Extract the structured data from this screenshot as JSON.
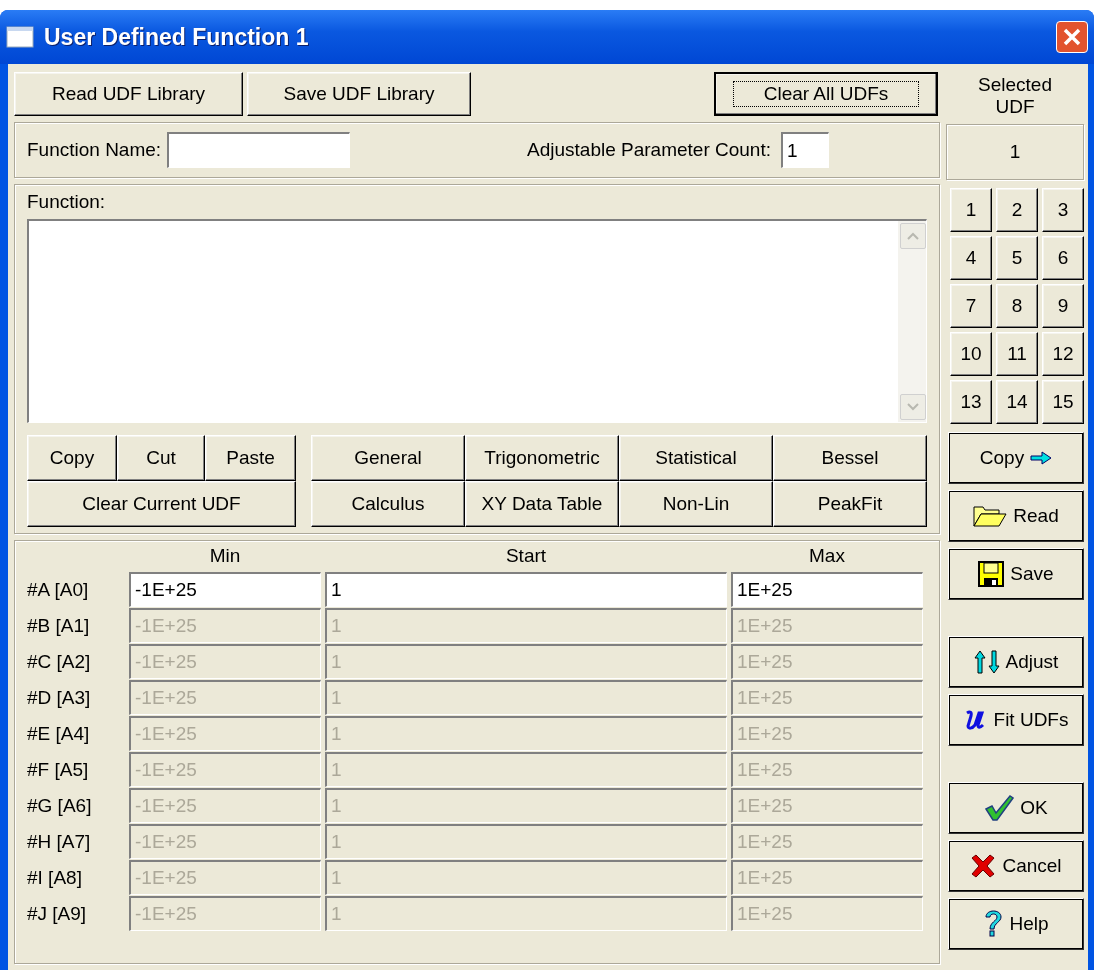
{
  "window": {
    "title": "User Defined Function 1"
  },
  "library_buttons": [
    {
      "label": "Read UDF Library",
      "focused": false
    },
    {
      "label": "Save UDF Library",
      "focused": false
    },
    {
      "label": "Clear All UDFs",
      "focused": true
    }
  ],
  "selected_udf": {
    "label": "Selected UDF",
    "value": "1"
  },
  "function_name": {
    "label": "Function Name:"
  },
  "parameter_count": {
    "label": "Adjustable Parameter Count:",
    "value": "1"
  },
  "function": {
    "label": "Function:"
  },
  "edit_buttons": [
    {
      "label": "Copy"
    },
    {
      "label": "Cut"
    },
    {
      "label": "Paste"
    },
    {
      "label": "Clear Current UDF"
    }
  ],
  "category_buttons": [
    {
      "label": "General"
    },
    {
      "label": "Trigonometric"
    },
    {
      "label": "Statistical"
    },
    {
      "label": "Bessel"
    },
    {
      "label": "Calculus"
    },
    {
      "label": "XY Data Table"
    },
    {
      "label": "Non-Lin"
    },
    {
      "label": "PeakFit"
    }
  ],
  "udf_slots": [
    {
      "label": "1"
    },
    {
      "label": "2"
    },
    {
      "label": "3"
    },
    {
      "label": "4"
    },
    {
      "label": "5"
    },
    {
      "label": "6"
    },
    {
      "label": "7"
    },
    {
      "label": "8"
    },
    {
      "label": "9"
    },
    {
      "label": "10"
    },
    {
      "label": "11"
    },
    {
      "label": "12"
    },
    {
      "label": "13"
    },
    {
      "label": "14"
    },
    {
      "label": "15"
    }
  ],
  "side_button_groups": [
    {
      "buttons": [
        {
          "label": "Copy",
          "kind": "arrow"
        },
        {
          "label": "Read",
          "kind": "folder"
        },
        {
          "label": "Save",
          "kind": "disk"
        }
      ]
    },
    {
      "buttons": [
        {
          "label": "Adjust",
          "kind": "updown"
        },
        {
          "label": "Fit UDFs",
          "kind": "curve"
        }
      ]
    },
    {
      "buttons": [
        {
          "label": "OK",
          "kind": "check"
        },
        {
          "label": "Cancel",
          "kind": "cross"
        },
        {
          "label": "Help",
          "kind": "question"
        }
      ]
    }
  ],
  "parameters": {
    "columns": [
      "Min",
      "Start",
      "Max"
    ],
    "rows": [
      {
        "label": "#A [A0]",
        "min": "-1E+25",
        "start": "1",
        "max": "1E+25",
        "disabled": false
      },
      {
        "label": "#B [A1]",
        "min": "-1E+25",
        "start": "1",
        "max": "1E+25",
        "disabled": true
      },
      {
        "label": "#C [A2]",
        "min": "-1E+25",
        "start": "1",
        "max": "1E+25",
        "disabled": true
      },
      {
        "label": "#D [A3]",
        "min": "-1E+25",
        "start": "1",
        "max": "1E+25",
        "disabled": true
      },
      {
        "label": "#E [A4]",
        "min": "-1E+25",
        "start": "1",
        "max": "1E+25",
        "disabled": true
      },
      {
        "label": "#F [A5]",
        "min": "-1E+25",
        "start": "1",
        "max": "1E+25",
        "disabled": true
      },
      {
        "label": "#G [A6]",
        "min": "-1E+25",
        "start": "1",
        "max": "1E+25",
        "disabled": true
      },
      {
        "label": "#H [A7]",
        "min": "-1E+25",
        "start": "1",
        "max": "1E+25",
        "disabled": true
      },
      {
        "label": "#I [A8]",
        "min": "-1E+25",
        "start": "1",
        "max": "1E+25",
        "disabled": true
      },
      {
        "label": "#J [A9]",
        "min": "-1E+25",
        "start": "1",
        "max": "1E+25",
        "disabled": true
      }
    ]
  }
}
